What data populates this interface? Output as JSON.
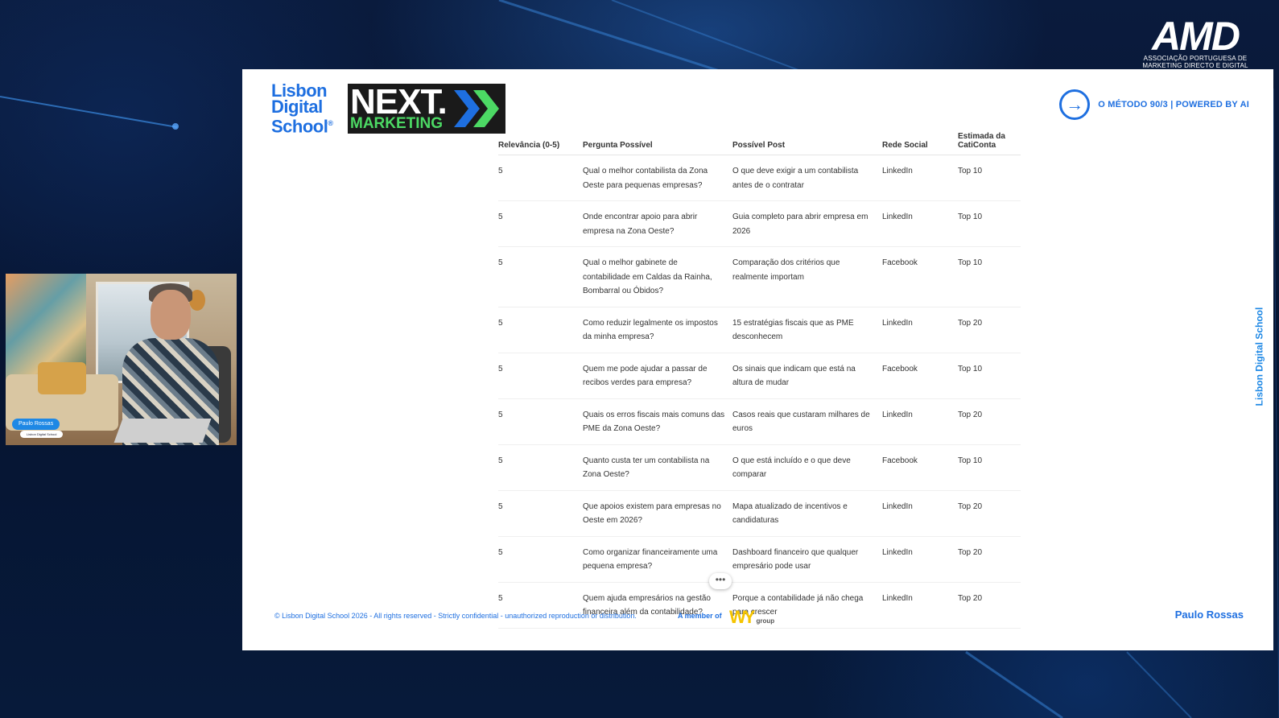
{
  "background": {
    "brand_logo": "AMD",
    "brand_subtitle_line1": "ASSOCIAÇÃO PORTUGUESA DE",
    "brand_subtitle_line2": "MARKETING DIRECTO E DIGITAL"
  },
  "webcam": {
    "name_tag": "Paulo Rossas",
    "sub_tag": "Lisbon Digital School"
  },
  "slide": {
    "logo_lds_line1": "Lisbon",
    "logo_lds_line2": "Digital",
    "logo_lds_line3": "School",
    "logo_next": "NEXT.",
    "logo_marketing": "MARKETING",
    "method_title": "O MÉTODO 90/3 | POWERED BY AI",
    "side_brand": "Lisbon Digital School",
    "table": {
      "headers": [
        "Relevância (0-5)",
        "Pergunta Possível",
        "Possível Post",
        "Rede Social",
        "Estimada da CatiConta"
      ],
      "rows": [
        [
          "5",
          "Qual o melhor contabilista da Zona Oeste para pequenas empresas?",
          "O que deve exigir a um contabilista antes de o contratar",
          "LinkedIn",
          "Top 10"
        ],
        [
          "5",
          "Onde encontrar apoio para abrir empresa na Zona Oeste?",
          "Guia completo para abrir empresa em 2026",
          "LinkedIn",
          "Top 10"
        ],
        [
          "5",
          "Qual o melhor gabinete de contabilidade em Caldas da Rainha, Bombarral ou Óbidos?",
          "Comparação dos critérios que realmente importam",
          "Facebook",
          "Top 10"
        ],
        [
          "5",
          "Como reduzir legalmente os impostos da minha empresa?",
          "15 estratégias fiscais que as PME desconhecem",
          "LinkedIn",
          "Top 20"
        ],
        [
          "5",
          "Quem me pode ajudar a passar de recibos verdes para empresa?",
          "Os sinais que indicam que está na altura de mudar",
          "Facebook",
          "Top 10"
        ],
        [
          "5",
          "Quais os erros fiscais mais comuns das PME da Zona Oeste?",
          "Casos reais que custaram milhares de euros",
          "LinkedIn",
          "Top 20"
        ],
        [
          "5",
          "Quanto custa ter um contabilista na Zona Oeste?",
          "O que está incluído e o que deve comparar",
          "Facebook",
          "Top 10"
        ],
        [
          "5",
          "Que apoios existem para empresas no Oeste em 2026?",
          "Mapa atualizado de incentivos e candidaturas",
          "LinkedIn",
          "Top 20"
        ],
        [
          "5",
          "Como organizar financeiramente uma pequena empresa?",
          "Dashboard financeiro que qualquer empresário pode usar",
          "LinkedIn",
          "Top 20"
        ],
        [
          "5",
          "Quem ajuda empresários na gestão financeira além da contabilidade?",
          "Porque a contabilidade já não chega para crescer",
          "LinkedIn",
          "Top 20"
        ]
      ]
    },
    "footer_text": "© Lisbon Digital School 2026 - All rights reserved - Strictly confidential - unauthorized reproduction or distribution.",
    "member_text": "A member of",
    "member_logo": "WY",
    "member_logo_sub": "group",
    "author": "Paulo Rossas",
    "more_button": "•••"
  },
  "colors": {
    "accent": "#1e6fe0",
    "next_green": "#4cd964",
    "background": "#061431"
  }
}
